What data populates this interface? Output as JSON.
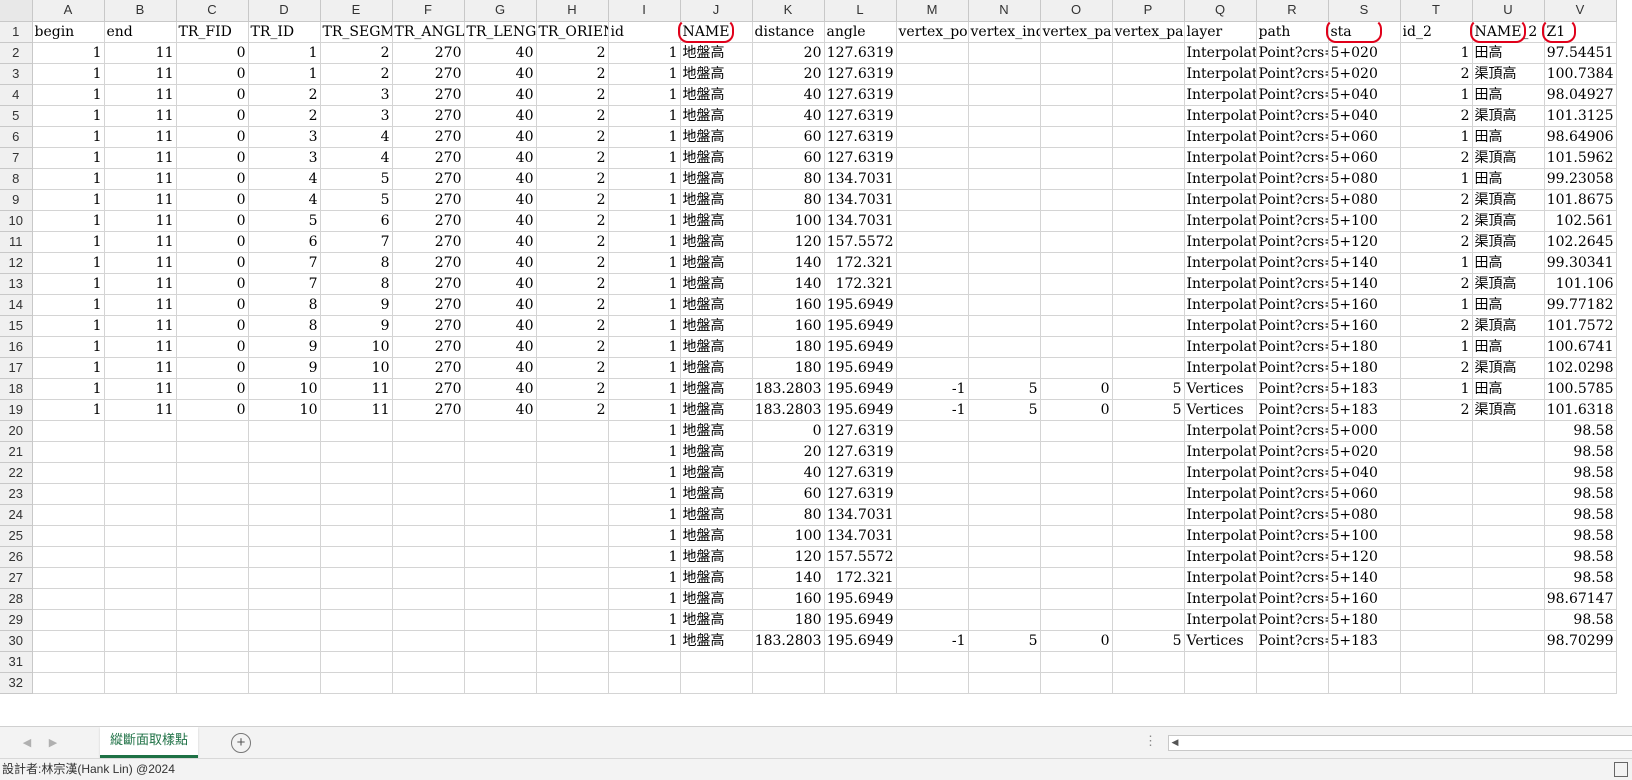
{
  "columns": [
    "A",
    "B",
    "C",
    "D",
    "E",
    "F",
    "G",
    "H",
    "I",
    "J",
    "K",
    "L",
    "M",
    "N",
    "O",
    "P",
    "Q",
    "R",
    "S",
    "T",
    "U",
    "V"
  ],
  "headers": [
    "begin",
    "end",
    "TR_FID",
    "TR_ID",
    "TR_SEGM",
    "TR_ANGL",
    "TR_LENG",
    "TR_ORIEN",
    "id",
    "NAME",
    "distance",
    "angle",
    "vertex_pos",
    "vertex_ind",
    "vertex_par",
    "vertex_par",
    "layer",
    "path",
    "sta",
    "id_2",
    "NAME_2",
    "Z1"
  ],
  "rows": [
    [
      "1",
      "11",
      "0",
      "1",
      "2",
      "270",
      "40",
      "2",
      "1",
      "地盤高",
      "20",
      "127.6319",
      "",
      "",
      "",
      "",
      "Interpolate",
      "Point?crs=I",
      "5+020",
      "1",
      "田高",
      "97.54451"
    ],
    [
      "1",
      "11",
      "0",
      "1",
      "2",
      "270",
      "40",
      "2",
      "1",
      "地盤高",
      "20",
      "127.6319",
      "",
      "",
      "",
      "",
      "Interpolate",
      "Point?crs=I",
      "5+020",
      "2",
      "渠頂高",
      "100.7384"
    ],
    [
      "1",
      "11",
      "0",
      "2",
      "3",
      "270",
      "40",
      "2",
      "1",
      "地盤高",
      "40",
      "127.6319",
      "",
      "",
      "",
      "",
      "Interpolate",
      "Point?crs=I",
      "5+040",
      "1",
      "田高",
      "98.04927"
    ],
    [
      "1",
      "11",
      "0",
      "2",
      "3",
      "270",
      "40",
      "2",
      "1",
      "地盤高",
      "40",
      "127.6319",
      "",
      "",
      "",
      "",
      "Interpolate",
      "Point?crs=I",
      "5+040",
      "2",
      "渠頂高",
      "101.3125"
    ],
    [
      "1",
      "11",
      "0",
      "3",
      "4",
      "270",
      "40",
      "2",
      "1",
      "地盤高",
      "60",
      "127.6319",
      "",
      "",
      "",
      "",
      "Interpolate",
      "Point?crs=I",
      "5+060",
      "1",
      "田高",
      "98.64906"
    ],
    [
      "1",
      "11",
      "0",
      "3",
      "4",
      "270",
      "40",
      "2",
      "1",
      "地盤高",
      "60",
      "127.6319",
      "",
      "",
      "",
      "",
      "Interpolate",
      "Point?crs=I",
      "5+060",
      "2",
      "渠頂高",
      "101.5962"
    ],
    [
      "1",
      "11",
      "0",
      "4",
      "5",
      "270",
      "40",
      "2",
      "1",
      "地盤高",
      "80",
      "134.7031",
      "",
      "",
      "",
      "",
      "Interpolate",
      "Point?crs=I",
      "5+080",
      "1",
      "田高",
      "99.23058"
    ],
    [
      "1",
      "11",
      "0",
      "4",
      "5",
      "270",
      "40",
      "2",
      "1",
      "地盤高",
      "80",
      "134.7031",
      "",
      "",
      "",
      "",
      "Interpolate",
      "Point?crs=I",
      "5+080",
      "2",
      "渠頂高",
      "101.8675"
    ],
    [
      "1",
      "11",
      "0",
      "5",
      "6",
      "270",
      "40",
      "2",
      "1",
      "地盤高",
      "100",
      "134.7031",
      "",
      "",
      "",
      "",
      "Interpolate",
      "Point?crs=I",
      "5+100",
      "2",
      "渠頂高",
      "102.561"
    ],
    [
      "1",
      "11",
      "0",
      "6",
      "7",
      "270",
      "40",
      "2",
      "1",
      "地盤高",
      "120",
      "157.5572",
      "",
      "",
      "",
      "",
      "Interpolate",
      "Point?crs=I",
      "5+120",
      "2",
      "渠頂高",
      "102.2645"
    ],
    [
      "1",
      "11",
      "0",
      "7",
      "8",
      "270",
      "40",
      "2",
      "1",
      "地盤高",
      "140",
      "172.321",
      "",
      "",
      "",
      "",
      "Interpolate",
      "Point?crs=I",
      "5+140",
      "1",
      "田高",
      "99.30341"
    ],
    [
      "1",
      "11",
      "0",
      "7",
      "8",
      "270",
      "40",
      "2",
      "1",
      "地盤高",
      "140",
      "172.321",
      "",
      "",
      "",
      "",
      "Interpolate",
      "Point?crs=I",
      "5+140",
      "2",
      "渠頂高",
      "101.106"
    ],
    [
      "1",
      "11",
      "0",
      "8",
      "9",
      "270",
      "40",
      "2",
      "1",
      "地盤高",
      "160",
      "195.6949",
      "",
      "",
      "",
      "",
      "Interpolate",
      "Point?crs=I",
      "5+160",
      "1",
      "田高",
      "99.77182"
    ],
    [
      "1",
      "11",
      "0",
      "8",
      "9",
      "270",
      "40",
      "2",
      "1",
      "地盤高",
      "160",
      "195.6949",
      "",
      "",
      "",
      "",
      "Interpolate",
      "Point?crs=I",
      "5+160",
      "2",
      "渠頂高",
      "101.7572"
    ],
    [
      "1",
      "11",
      "0",
      "9",
      "10",
      "270",
      "40",
      "2",
      "1",
      "地盤高",
      "180",
      "195.6949",
      "",
      "",
      "",
      "",
      "Interpolate",
      "Point?crs=I",
      "5+180",
      "1",
      "田高",
      "100.6741"
    ],
    [
      "1",
      "11",
      "0",
      "9",
      "10",
      "270",
      "40",
      "2",
      "1",
      "地盤高",
      "180",
      "195.6949",
      "",
      "",
      "",
      "",
      "Interpolate",
      "Point?crs=I",
      "5+180",
      "2",
      "渠頂高",
      "102.0298"
    ],
    [
      "1",
      "11",
      "0",
      "10",
      "11",
      "270",
      "40",
      "2",
      "1",
      "地盤高",
      "183.2803",
      "195.6949",
      "-1",
      "5",
      "0",
      "5",
      "Vertices",
      "Point?crs=I",
      "5+183",
      "1",
      "田高",
      "100.5785"
    ],
    [
      "1",
      "11",
      "0",
      "10",
      "11",
      "270",
      "40",
      "2",
      "1",
      "地盤高",
      "183.2803",
      "195.6949",
      "-1",
      "5",
      "0",
      "5",
      "Vertices",
      "Point?crs=I",
      "5+183",
      "2",
      "渠頂高",
      "101.6318"
    ],
    [
      "",
      "",
      "",
      "",
      "",
      "",
      "",
      "",
      "1",
      "地盤高",
      "0",
      "127.6319",
      "",
      "",
      "",
      "",
      "Interpolate",
      "Point?crs=I",
      "5+000",
      "",
      "",
      "98.58"
    ],
    [
      "",
      "",
      "",
      "",
      "",
      "",
      "",
      "",
      "1",
      "地盤高",
      "20",
      "127.6319",
      "",
      "",
      "",
      "",
      "Interpolate",
      "Point?crs=I",
      "5+020",
      "",
      "",
      "98.58"
    ],
    [
      "",
      "",
      "",
      "",
      "",
      "",
      "",
      "",
      "1",
      "地盤高",
      "40",
      "127.6319",
      "",
      "",
      "",
      "",
      "Interpolate",
      "Point?crs=I",
      "5+040",
      "",
      "",
      "98.58"
    ],
    [
      "",
      "",
      "",
      "",
      "",
      "",
      "",
      "",
      "1",
      "地盤高",
      "60",
      "127.6319",
      "",
      "",
      "",
      "",
      "Interpolate",
      "Point?crs=I",
      "5+060",
      "",
      "",
      "98.58"
    ],
    [
      "",
      "",
      "",
      "",
      "",
      "",
      "",
      "",
      "1",
      "地盤高",
      "80",
      "134.7031",
      "",
      "",
      "",
      "",
      "Interpolate",
      "Point?crs=I",
      "5+080",
      "",
      "",
      "98.58"
    ],
    [
      "",
      "",
      "",
      "",
      "",
      "",
      "",
      "",
      "1",
      "地盤高",
      "100",
      "134.7031",
      "",
      "",
      "",
      "",
      "Interpolate",
      "Point?crs=I",
      "5+100",
      "",
      "",
      "98.58"
    ],
    [
      "",
      "",
      "",
      "",
      "",
      "",
      "",
      "",
      "1",
      "地盤高",
      "120",
      "157.5572",
      "",
      "",
      "",
      "",
      "Interpolate",
      "Point?crs=I",
      "5+120",
      "",
      "",
      "98.58"
    ],
    [
      "",
      "",
      "",
      "",
      "",
      "",
      "",
      "",
      "1",
      "地盤高",
      "140",
      "172.321",
      "",
      "",
      "",
      "",
      "Interpolate",
      "Point?crs=I",
      "5+140",
      "",
      "",
      "98.58"
    ],
    [
      "",
      "",
      "",
      "",
      "",
      "",
      "",
      "",
      "1",
      "地盤高",
      "160",
      "195.6949",
      "",
      "",
      "",
      "",
      "Interpolate",
      "Point?crs=I",
      "5+160",
      "",
      "",
      "98.67147"
    ],
    [
      "",
      "",
      "",
      "",
      "",
      "",
      "",
      "",
      "1",
      "地盤高",
      "180",
      "195.6949",
      "",
      "",
      "",
      "",
      "Interpolate",
      "Point?crs=I",
      "5+180",
      "",
      "",
      "98.58"
    ],
    [
      "",
      "",
      "",
      "",
      "",
      "",
      "",
      "",
      "1",
      "地盤高",
      "183.2803",
      "195.6949",
      "-1",
      "5",
      "0",
      "5",
      "Vertices",
      "Point?crs=I",
      "5+183",
      "",
      "",
      "98.70299"
    ],
    [
      "",
      "",
      "",
      "",
      "",
      "",
      "",
      "",
      "",
      "",
      "",
      "",
      "",
      "",
      "",
      "",
      "",
      "",
      "",
      "",
      "",
      ""
    ],
    [
      "",
      "",
      "",
      "",
      "",
      "",
      "",
      "",
      "",
      "",
      "",
      "",
      "",
      "",
      "",
      "",
      "",
      "",
      "",
      "",
      "",
      ""
    ]
  ],
  "sheet_tab": "縱斷面取樣點",
  "add_sheet_icon": "plus-circle-icon",
  "status_text": "設計者:林宗漢(Hank Lin) @2024",
  "annotation_color": "#e0001a",
  "annotated_headers": [
    "NAME",
    "sta",
    "NAME_2",
    "Z1"
  ]
}
